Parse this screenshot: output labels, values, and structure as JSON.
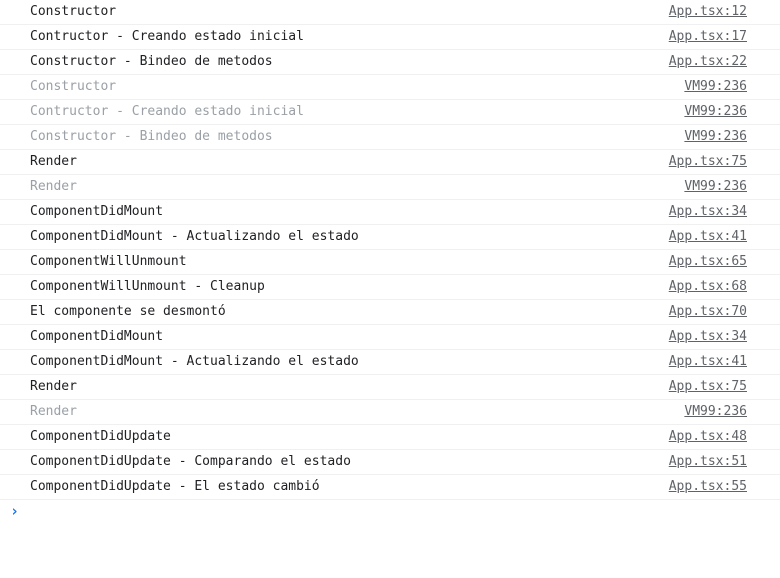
{
  "console": {
    "entries": [
      {
        "message": "Constructor",
        "source": "App.tsx:12",
        "faded": false
      },
      {
        "message": "Contructor - Creando estado inicial",
        "source": "App.tsx:17",
        "faded": false
      },
      {
        "message": "Constructor - Bindeo de metodos",
        "source": "App.tsx:22",
        "faded": false
      },
      {
        "message": "Constructor",
        "source": "VM99:236",
        "faded": true
      },
      {
        "message": "Contructor - Creando estado inicial",
        "source": "VM99:236",
        "faded": true
      },
      {
        "message": "Constructor - Bindeo de metodos",
        "source": "VM99:236",
        "faded": true
      },
      {
        "message": "Render",
        "source": "App.tsx:75",
        "faded": false
      },
      {
        "message": "Render",
        "source": "VM99:236",
        "faded": true
      },
      {
        "message": "ComponentDidMount",
        "source": "App.tsx:34",
        "faded": false
      },
      {
        "message": "ComponentDidMount - Actualizando el estado",
        "source": "App.tsx:41",
        "faded": false
      },
      {
        "message": "ComponentWillUnmount",
        "source": "App.tsx:65",
        "faded": false
      },
      {
        "message": "ComponentWillUnmount - Cleanup",
        "source": "App.tsx:68",
        "faded": false
      },
      {
        "message": "El componente se desmontó",
        "source": "App.tsx:70",
        "faded": false
      },
      {
        "message": "ComponentDidMount",
        "source": "App.tsx:34",
        "faded": false
      },
      {
        "message": "ComponentDidMount - Actualizando el estado",
        "source": "App.tsx:41",
        "faded": false
      },
      {
        "message": "Render",
        "source": "App.tsx:75",
        "faded": false
      },
      {
        "message": "Render",
        "source": "VM99:236",
        "faded": true
      },
      {
        "message": "ComponentDidUpdate",
        "source": "App.tsx:48",
        "faded": false
      },
      {
        "message": "ComponentDidUpdate - Comparando el estado",
        "source": "App.tsx:51",
        "faded": false
      },
      {
        "message": "ComponentDidUpdate - El estado cambió",
        "source": "App.tsx:55",
        "faded": false
      }
    ],
    "prompt_icon": "chevron-right-icon",
    "colors": {
      "text": "#202124",
      "faded_text": "#9aa0a6",
      "link": "#5f6368",
      "prompt": "#1a73e8",
      "divider": "#f0f0f0"
    }
  }
}
